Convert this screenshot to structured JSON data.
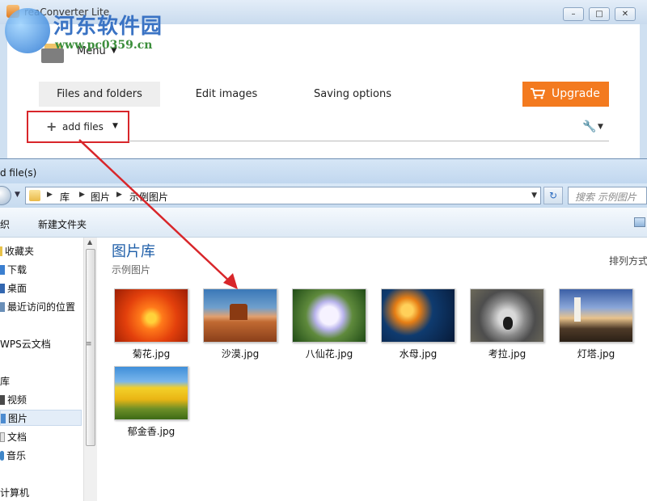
{
  "app": {
    "title": "reaConverter Lite",
    "menu_label": "Menu",
    "tabs": [
      {
        "label": "Files and folders"
      },
      {
        "label": "Edit images"
      },
      {
        "label": "Saving options"
      }
    ],
    "upgrade_label": "Upgrade",
    "add_files_label": "add files",
    "accent_color": "#f37a1f",
    "highlight_color": "#d8262a"
  },
  "watermark": {
    "line1": "河东软件园",
    "line2": "www.pc0359.cn"
  },
  "dialog": {
    "title": "d file(s)",
    "breadcrumb": [
      "库",
      "图片",
      "示例图片"
    ],
    "search_placeholder": "搜索 示例图片",
    "organize_label": "织",
    "new_folder_label": "新建文件夹",
    "nav_items": [
      {
        "label": "收藏夹",
        "icon": "star-icon"
      },
      {
        "label": "下载",
        "icon": "download-icon"
      },
      {
        "label": "桌面",
        "icon": "desktop-icon"
      },
      {
        "label": "最近访问的位置",
        "icon": "recent-icon"
      },
      {
        "label": "WPS云文档",
        "icon": "cloud-icon"
      },
      {
        "label": "库",
        "icon": "library-icon"
      },
      {
        "label": "视频",
        "icon": "video-icon"
      },
      {
        "label": "图片",
        "icon": "pictures-icon"
      },
      {
        "label": "文档",
        "icon": "documents-icon"
      },
      {
        "label": "音乐",
        "icon": "music-icon"
      },
      {
        "label": "计算机",
        "icon": "computer-icon"
      }
    ],
    "library_title": "图片库",
    "library_subtitle": "示例图片",
    "arrange_label": "排列方式",
    "files": [
      {
        "name": "菊花.jpg"
      },
      {
        "name": "沙漠.jpg"
      },
      {
        "name": "八仙花.jpg"
      },
      {
        "name": "水母.jpg"
      },
      {
        "name": "考拉.jpg"
      },
      {
        "name": "灯塔.jpg"
      },
      {
        "name": "郁金香.jpg"
      }
    ]
  }
}
